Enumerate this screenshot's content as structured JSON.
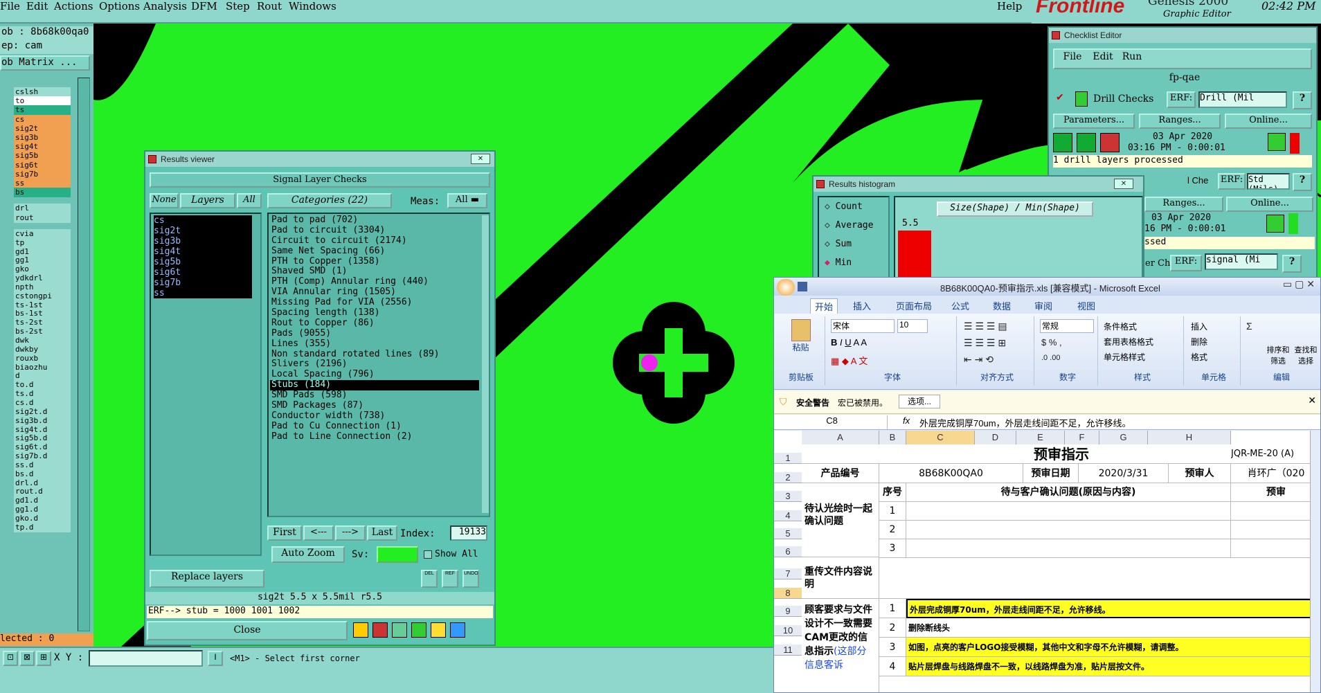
{
  "menubar": {
    "items": [
      "File",
      "Edit",
      "Actions",
      "Options",
      "Analysis",
      "DFM",
      "Step",
      "Rout",
      "Windows"
    ],
    "help": "Help"
  },
  "app": {
    "brand": "Frontline",
    "product": "Genesis 2000",
    "sub": "Graphic Editor",
    "clock": "02:42 PM"
  },
  "left": {
    "job": "ob : 8b68k00qa0",
    "step": "ep: cam",
    "matrix": "ob Matrix ...",
    "layers1": [
      "cslsh",
      "to",
      "ts",
      "cs",
      "sig2t",
      "sig3b",
      "sig4t",
      "sig5b",
      "sig6t",
      "sig7b",
      "ss",
      "bs"
    ],
    "layers2": [
      "drl",
      "rout"
    ],
    "layers3": [
      "cvia",
      "tp",
      "gd1",
      "gg1",
      "gko",
      "ydkdrl",
      "npth",
      "cstongpi",
      "ts-1st",
      "bs-1st",
      "ts-2st",
      "bs-2st",
      "dwk",
      "dwkby",
      "rouxb",
      "biaozhu",
      "d",
      "to.d",
      "ts.d",
      "cs.d",
      "sig2t.d",
      "sig3b.d",
      "sig4t.d",
      "sig5b.d",
      "sig6t.d",
      "sig7b.d",
      "ss.d",
      "bs.d",
      "drl.d",
      "rout.d",
      "gd1.d",
      "gg1.d",
      "gko.d",
      "tp.d"
    ],
    "selected": "lected : 0"
  },
  "status": {
    "xy_label": "X Y :",
    "xy_value": "",
    "hint": "<M1> - Select first corner"
  },
  "rv": {
    "title": "Results viewer",
    "header": "Signal Layer Checks",
    "none": "None",
    "layers": "Layers",
    "all": "All",
    "categories": "Categories (22)",
    "meas": "Meas:",
    "meas_val": "All",
    "layer_list": [
      "cs",
      "sig2t",
      "sig3b",
      "sig4t",
      "sig5b",
      "sig6t",
      "sig7b",
      "ss"
    ],
    "cat_list": [
      "Pad to pad (702)",
      "Pad to circuit (3304)",
      "Circuit to circuit (2174)",
      "Same Net Spacing (66)",
      "PTH to Copper (1358)",
      "Shaved SMD (1)",
      "PTH (Comp) Annular ring (440)",
      "VIA Annular ring (1505)",
      "Missing Pad for VIA (2556)",
      "Spacing length (138)",
      "Rout to Copper (86)",
      "Pads (9055)",
      "Lines (355)",
      "Non standard rotated lines (89)",
      "Slivers (2196)",
      "Local Spacing (796)",
      "Stubs (184)",
      "SMD Pads (598)",
      "SMD Packages (87)",
      "Conductor width (738)",
      "Pad to Cu Connection (1)",
      "Pad to Line Connection (2)"
    ],
    "selected_cat": 16,
    "first": "First",
    "prev": "<---",
    "next": "--->",
    "last": "Last",
    "index_label": "Index:",
    "index": "19133",
    "autozoom": "Auto Zoom",
    "sv": "Sv:",
    "showall": "Show All",
    "replace": "Replace layers",
    "del": "DEL",
    "ref": "REF",
    "undo": "UNDO",
    "info": "sig2t 5.5 x 5.5mil  r5.5",
    "erf": "ERF--> stub = 1000 1001 1002",
    "close": "Close"
  },
  "ce": {
    "title": "Checklist Editor",
    "menu": [
      "File",
      "Edit",
      "Run"
    ],
    "name": "fp-qae",
    "drill": "Drill Checks",
    "erf": "ERF:",
    "drill_erf": "Drill (Mil",
    "params": "Parameters...",
    "ranges": "Ranges...",
    "online": "Online...",
    "date1": "03 Apr 2020",
    "time1": "03:16 PM - 0:00:01",
    "processed1": "1 drill layers processed",
    "check2": "l Che",
    "erf2": "Std (Mils)",
    "ranges2": "Ranges...",
    "online2": "Online...",
    "date2": "03 Apr 2020",
    "time2": "16 PM - 0:00:01",
    "processed2": "ssed",
    "check3": "er Ch",
    "erf3": "signal (Mi"
  },
  "hist": {
    "title": "Results histogram",
    "opts": [
      "Count",
      "Average",
      "Sum",
      "Min"
    ],
    "selected": 3,
    "axis": "Size(Shape) / Min(Shape)",
    "value": "5.5"
  },
  "excel": {
    "title": "8B68K00QA0-预审指示.xls [兼容模式] - Microsoft Excel",
    "tabs": [
      "开始",
      "插入",
      "页面布局",
      "公式",
      "数据",
      "审阅",
      "视图"
    ],
    "font": "宋体",
    "size": "10",
    "numfmt": "常规",
    "groups": [
      "剪贴板",
      "字体",
      "对齐方式",
      "数字",
      "样式",
      "单元格",
      "编辑"
    ],
    "paste": "粘贴",
    "cond": "条件格式",
    "table": "套用表格格式",
    "cellstyle": "单元格样式",
    "insert": "插入",
    "delete": "删除",
    "format": "格式",
    "sortf": "排序和筛选",
    "find": "查找和选择",
    "warn": "安全警告",
    "warn_text": "宏已被禁用。",
    "options": "选项...",
    "namebox": "C8",
    "formula": "外层完成铜厚70um，外层走线间距不足，允许移线。",
    "cols": [
      "A",
      "B",
      "C",
      "D",
      "E",
      "F",
      "G",
      "H"
    ],
    "rows": [
      "1",
      "2",
      "3",
      "4",
      "5",
      "6",
      "7",
      "8",
      "9",
      "10",
      "11"
    ],
    "r1_title": "预审指示",
    "r1_code": "JQR-ME-20 (A)",
    "r2": [
      "产品编号",
      "8B68K00QA0",
      "预审日期",
      "2020/3/31",
      "预审人",
      "肖环广（020"
    ],
    "r3": [
      "序号",
      "待与客户确认问题(原因与内容)",
      "预审"
    ],
    "r4_label": "待认光绘时一起确认问题",
    "seq": [
      "1",
      "2",
      "3"
    ],
    "r7_label": "重传文件内容说明",
    "r8_label": "顾客要求与文件设计不一致需要CAM更改的信息指示",
    "r8_link": "(这部分信息客诉",
    "items": [
      "外层完成铜厚70um，外层走线间距不足，允许移线。",
      "删除断线头",
      "如图，点亮的客户LOGO接受模糊，其他中文和字母不允许模糊，请调整。",
      "贴片层焊盘与线路焊盘不一致，以线路焊盘为准，贴片层按文件。"
    ],
    "items_seq": [
      "1",
      "2",
      "3",
      "4"
    ]
  }
}
